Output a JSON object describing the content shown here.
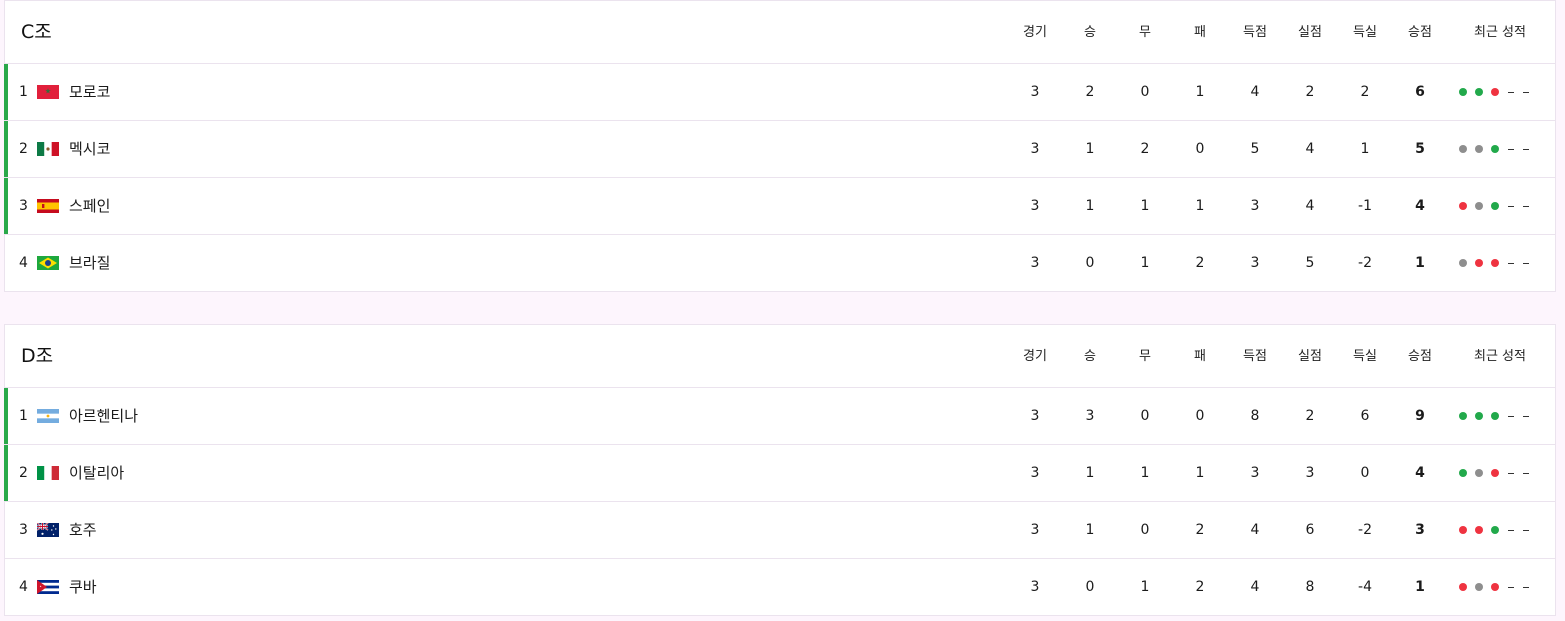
{
  "columns": [
    "경기",
    "승",
    "무",
    "패",
    "득점",
    "실점",
    "득실",
    "승점"
  ],
  "form_header": "최근 성적",
  "colors": {
    "qualified_bar": "#2aa84a",
    "win": "#22a94b",
    "draw": "#8e8e8e",
    "loss": "#ef3340",
    "empty": "#333333"
  },
  "groups": [
    {
      "title": "C조",
      "rows": [
        {
          "rank": "1",
          "flag": "flag-morocco-icon",
          "team": "모로코",
          "stats": [
            "3",
            "2",
            "0",
            "1",
            "4",
            "2",
            "2",
            "6"
          ],
          "form": [
            "W",
            "W",
            "L",
            "-",
            "-"
          ],
          "qualified": true
        },
        {
          "rank": "2",
          "flag": "flag-mexico-icon",
          "team": "멕시코",
          "stats": [
            "3",
            "1",
            "2",
            "0",
            "5",
            "4",
            "1",
            "5"
          ],
          "form": [
            "D",
            "D",
            "W",
            "-",
            "-"
          ],
          "qualified": true
        },
        {
          "rank": "3",
          "flag": "flag-spain-icon",
          "team": "스페인",
          "stats": [
            "3",
            "1",
            "1",
            "1",
            "3",
            "4",
            "-1",
            "4"
          ],
          "form": [
            "L",
            "D",
            "W",
            "-",
            "-"
          ],
          "qualified": true
        },
        {
          "rank": "4",
          "flag": "flag-brazil-icon",
          "team": "브라질",
          "stats": [
            "3",
            "0",
            "1",
            "2",
            "3",
            "5",
            "-2",
            "1"
          ],
          "form": [
            "D",
            "L",
            "L",
            "-",
            "-"
          ],
          "qualified": false
        }
      ]
    },
    {
      "title": "D조",
      "rows": [
        {
          "rank": "1",
          "flag": "flag-argentina-icon",
          "team": "아르헨티나",
          "stats": [
            "3",
            "3",
            "0",
            "0",
            "8",
            "2",
            "6",
            "9"
          ],
          "form": [
            "W",
            "W",
            "W",
            "-",
            "-"
          ],
          "qualified": true
        },
        {
          "rank": "2",
          "flag": "flag-italy-icon",
          "team": "이탈리아",
          "stats": [
            "3",
            "1",
            "1",
            "1",
            "3",
            "3",
            "0",
            "4"
          ],
          "form": [
            "W",
            "D",
            "L",
            "-",
            "-"
          ],
          "qualified": true
        },
        {
          "rank": "3",
          "flag": "flag-australia-icon",
          "team": "호주",
          "stats": [
            "3",
            "1",
            "0",
            "2",
            "4",
            "6",
            "-2",
            "3"
          ],
          "form": [
            "L",
            "L",
            "W",
            "-",
            "-"
          ],
          "qualified": false
        },
        {
          "rank": "4",
          "flag": "flag-cuba-icon",
          "team": "쿠바",
          "stats": [
            "3",
            "0",
            "1",
            "2",
            "4",
            "8",
            "-4",
            "1"
          ],
          "form": [
            "L",
            "D",
            "L",
            "-",
            "-"
          ],
          "qualified": false
        }
      ]
    }
  ]
}
